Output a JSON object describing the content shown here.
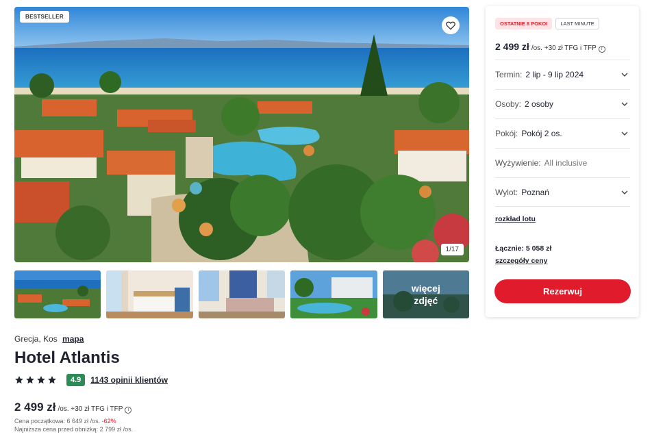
{
  "gallery": {
    "badge": "BESTSELLER",
    "counter": "1/17",
    "favorite_icon": "heart-icon",
    "more_photos_label": "więcej\nzdjęć"
  },
  "hotel": {
    "location": "Grecja, Kos",
    "map_link": "mapa",
    "name": "Hotel Atlantis",
    "stars": 4,
    "score": "4.9",
    "reviews_link": "1143 opinii klientów"
  },
  "pricing": {
    "price": "2 499 zł",
    "suffix": "/os. +30 zł TFG i TFP",
    "original_label": "Cena początkowa: 6 649 zł /os.",
    "discount": "-62%",
    "lowest_label": "Najniższa cena przed obniżką: 2 799 zł /os."
  },
  "booking": {
    "tag_rooms": "OSTATNIE 8 POKOI",
    "tag_last_minute": "LAST MINUTE",
    "price": "2 499 zł",
    "price_suffix": "/os. +30 zł TFG i TFP",
    "rows": [
      {
        "label": "Termin:",
        "value": "2 lip - 9 lip 2024"
      },
      {
        "label": "Osoby:",
        "value": "2 osoby"
      },
      {
        "label": "Pokój:",
        "value": "Pokój 2 os."
      },
      {
        "label": "Wyżywienie:",
        "value": "All inclusive"
      },
      {
        "label": "Wylot:",
        "value": "Poznań"
      }
    ],
    "flight_link": "rozkład lotu",
    "total": "Łącznie: 5 058 zł",
    "price_details_link": "szczegóły ceny",
    "reserve_button": "Rezerwuj"
  },
  "colors": {
    "accent": "#e01c2c",
    "score_green": "#2e8a57",
    "tag_red_bg": "#fde3e5"
  }
}
